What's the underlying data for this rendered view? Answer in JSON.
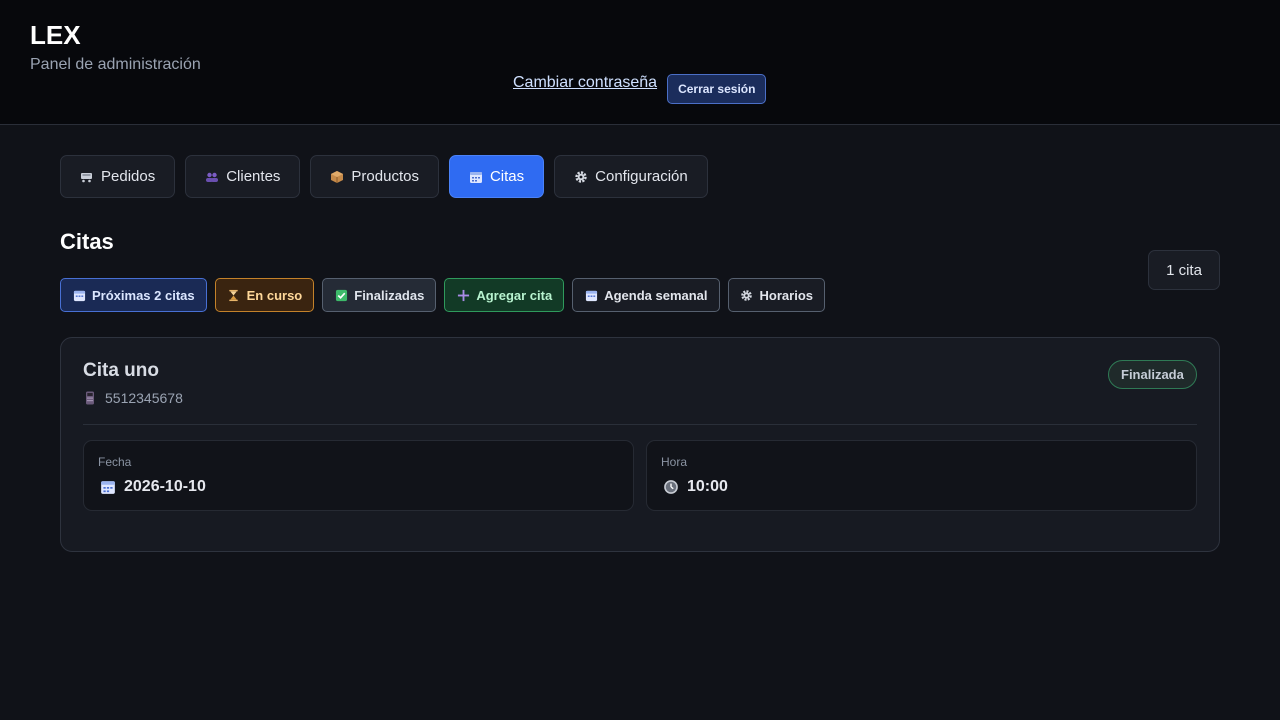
{
  "header": {
    "title": "LEX",
    "subtitle": "Panel de administración",
    "change_password": "Cambiar contraseña",
    "logout": "Cerrar sesión"
  },
  "tabs": [
    {
      "label": "Pedidos",
      "icon": "cart-icon",
      "active": false
    },
    {
      "label": "Clientes",
      "icon": "users-icon",
      "active": false
    },
    {
      "label": "Productos",
      "icon": "box-icon",
      "active": false
    },
    {
      "label": "Citas",
      "icon": "calendar-icon",
      "active": true
    },
    {
      "label": "Configuración",
      "icon": "gear-icon",
      "active": false
    }
  ],
  "section": {
    "title": "Citas",
    "count": "1 cita"
  },
  "filters": [
    {
      "label": "Próximas 2 citas",
      "icon": "calendar-icon"
    },
    {
      "label": "En curso",
      "icon": "hourglass-icon"
    },
    {
      "label": "Finalizadas",
      "icon": "check-icon"
    },
    {
      "label": "Agregar cita",
      "icon": "plus-icon"
    },
    {
      "label": "Agenda semanal",
      "icon": "calendar-icon"
    },
    {
      "label": "Horarios",
      "icon": "gear-icon"
    }
  ],
  "appointment": {
    "title": "Cita uno",
    "phone": "5512345678",
    "status": "Finalizada",
    "date_label": "Fecha",
    "date_value": "2026-10-10",
    "time_label": "Hora",
    "time_value": "10:00"
  },
  "colors": {
    "accent": "#2f6bf2",
    "background": "#101218",
    "header_background": "#07080c"
  }
}
